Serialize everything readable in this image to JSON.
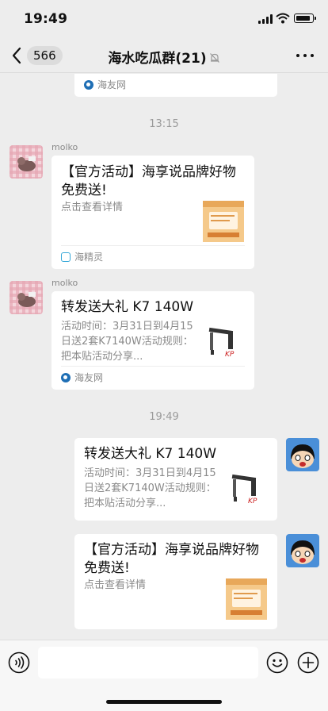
{
  "status_bar": {
    "time": "19:49"
  },
  "nav": {
    "unread_count": "566",
    "title": "海水吃瓜群(21)"
  },
  "messages": [
    {
      "source": "海友网"
    },
    {
      "time": "13:15"
    },
    {
      "sender": "molko",
      "title": "【官方活动】海享说品牌好物免费送!",
      "desc": "点击查看详情",
      "source": "海精灵"
    },
    {
      "sender": "molko",
      "title": "转发送大礼 K7 140W",
      "desc": "活动时间：3月31日到4月15日送2套K7140W活动规则：把本贴活动分享...",
      "source": "海友网"
    },
    {
      "time": "19:49"
    },
    {
      "title": "转发送大礼 K7 140W",
      "desc": "活动时间：3月31日到4月15日送2套K7140W活动规则：把本贴活动分享..."
    },
    {
      "title": "【官方活动】海享说品牌好物免费送!",
      "desc": "点击查看详情"
    }
  ],
  "thumbnails": {
    "lamp_logo": "KP"
  },
  "input": {
    "placeholder": ""
  },
  "colors": {
    "background": "#ededed",
    "card": "#ffffff",
    "meta_text": "#8a8a8a",
    "nav_badge": "#dcdcdc"
  }
}
